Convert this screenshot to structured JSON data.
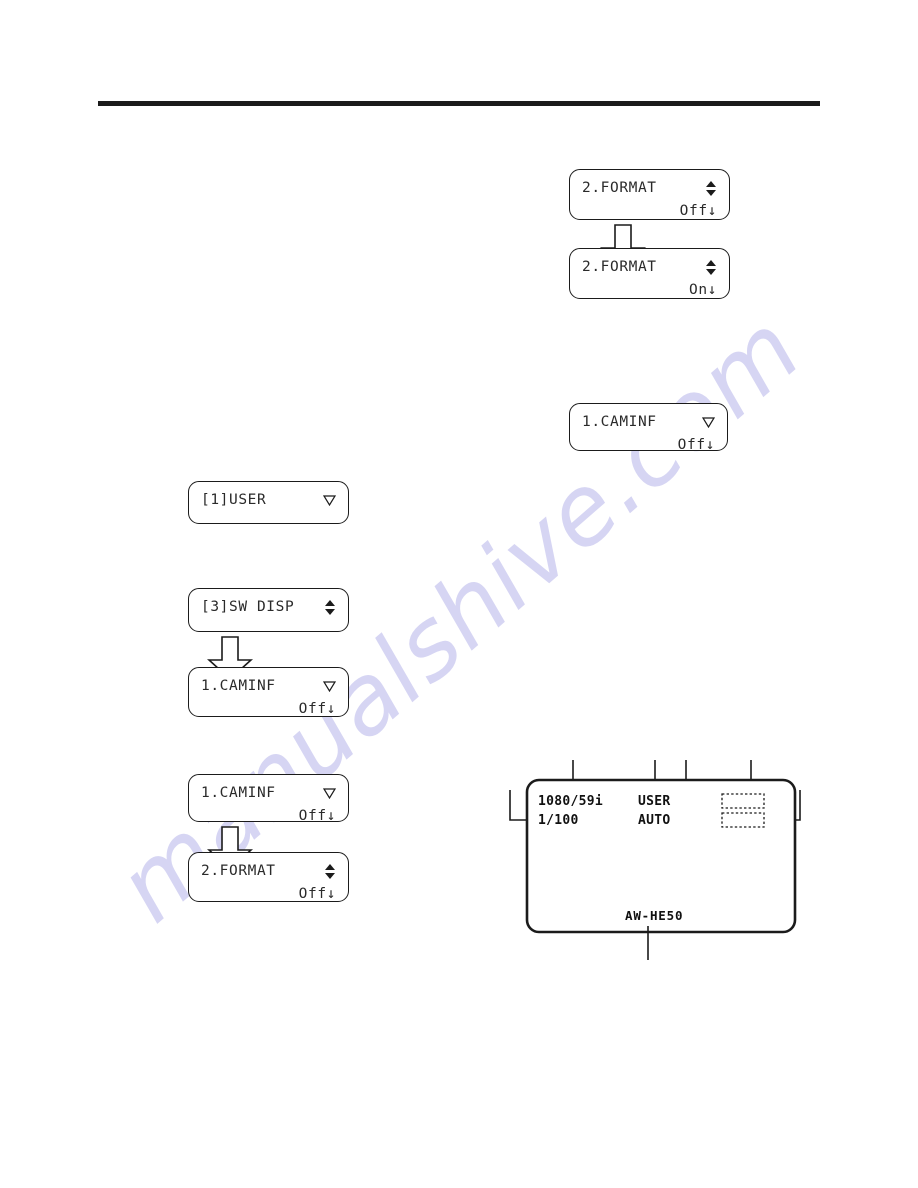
{
  "page": {
    "watermark": "manualshive.com",
    "background_color": "#ffffff",
    "rule_color": "#1b1b1b"
  },
  "panels": {
    "format_off": {
      "line1_label": "2.FORMAT",
      "line1_glyph": "up-down-arrow-icon",
      "line2_value": "Off↓"
    },
    "format_on": {
      "line1_label": "2.FORMAT",
      "line1_glyph": "up-down-arrow-icon",
      "line2_value": "On↓"
    },
    "caminf_right": {
      "line1_label": "1.CAMINF",
      "line1_glyph": "down-triangle-icon",
      "line2_value": "Off↓"
    },
    "user_menu": {
      "line1_label": "[1]USER",
      "line1_glyph": "down-triangle-icon",
      "line2_value": ""
    },
    "sw_disp": {
      "line1_label": "[3]SW DISP",
      "line1_glyph": "up-down-arrow-icon",
      "line2_value": ""
    },
    "caminf_mid": {
      "line1_label": "1.CAMINF",
      "line1_glyph": "down-triangle-icon",
      "line2_value": "Off↓"
    },
    "caminf_low": {
      "line1_label": "1.CAMINF",
      "line1_glyph": "down-triangle-icon",
      "line2_value": "Off↓"
    },
    "format_low": {
      "line1_label": "2.FORMAT",
      "line1_glyph": "up-down-arrow-icon",
      "line2_value": "Off↓"
    }
  },
  "monitor": {
    "osd": {
      "format_line": "1080/59i",
      "shutter_line": "1/100",
      "mode_line": "USER",
      "iris_line": "AUTO",
      "model_name": "AW-HE50"
    },
    "placeholder_boxes": 2
  }
}
